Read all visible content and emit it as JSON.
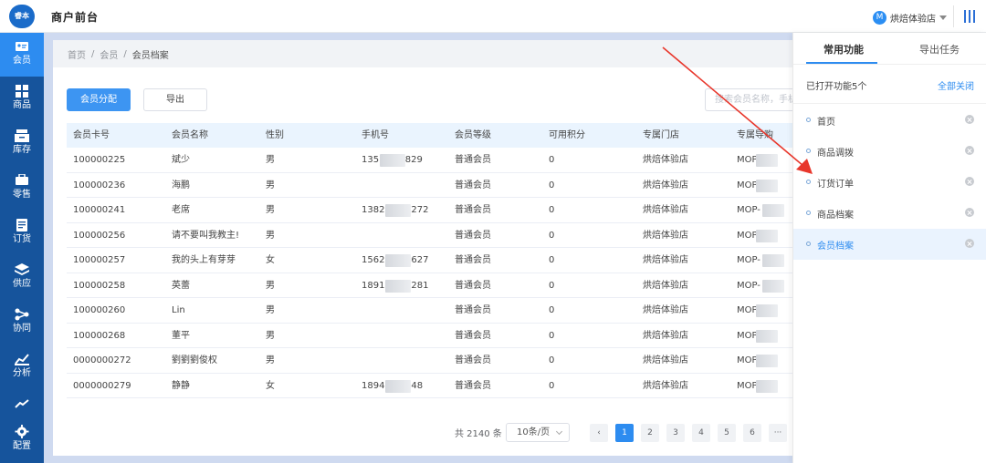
{
  "header": {
    "logo_text": "睿本",
    "title": "商户前台",
    "store_badge": "M",
    "store_name": "烘焙体验店"
  },
  "sidebar": {
    "items": [
      {
        "label": "会员",
        "icon": "member-card-icon",
        "active": true
      },
      {
        "label": "商品",
        "icon": "grid-icon"
      },
      {
        "label": "库存",
        "icon": "inventory-icon"
      },
      {
        "label": "零售",
        "icon": "retail-icon"
      },
      {
        "label": "订货",
        "icon": "order-icon"
      },
      {
        "label": "供应",
        "icon": "layers-icon"
      },
      {
        "label": "协同",
        "icon": "share-icon"
      },
      {
        "label": "分析",
        "icon": "chart-icon"
      },
      {
        "label": "配置",
        "icon": "gear-icon"
      }
    ]
  },
  "breadcrumb": {
    "home": "首页",
    "section": "会员",
    "current": "会员档案"
  },
  "toolbar": {
    "assign_label": "会员分配",
    "export_label": "导出",
    "search_placeholder": "搜索会员名称，手机"
  },
  "table": {
    "columns": [
      "会员卡号",
      "会员名称",
      "性别",
      "手机号",
      "会员等级",
      "可用积分",
      "专属门店",
      "专属导购"
    ],
    "rows": [
      {
        "card": "100000225",
        "name": "斌少",
        "gender": "男",
        "phone_a": "135",
        "phone_b": "829",
        "level": "普通会员",
        "points": "0",
        "store": "烘焙体验店",
        "guide": "MOP"
      },
      {
        "card": "100000236",
        "name": "海鹏",
        "gender": "男",
        "phone_a": "",
        "phone_b": "",
        "level": "普通会员",
        "points": "0",
        "store": "烘焙体验店",
        "guide": "MOP"
      },
      {
        "card": "100000241",
        "name": "老席",
        "gender": "男",
        "phone_a": "1382",
        "phone_b": "272",
        "level": "普通会员",
        "points": "0",
        "store": "烘焙体验店",
        "guide": "MOP-"
      },
      {
        "card": "100000256",
        "name": "请不要叫我教主!",
        "gender": "男",
        "phone_a": "",
        "phone_b": "",
        "level": "普通会员",
        "points": "0",
        "store": "烘焙体验店",
        "guide": "MOP"
      },
      {
        "card": "100000257",
        "name": "我的头上有芽芽",
        "gender": "女",
        "phone_a": "1562",
        "phone_b": "627",
        "level": "普通会员",
        "points": "0",
        "store": "烘焙体验店",
        "guide": "MOP-"
      },
      {
        "card": "100000258",
        "name": "英蕾",
        "gender": "男",
        "phone_a": "1891",
        "phone_b": "281",
        "level": "普通会员",
        "points": "0",
        "store": "烘焙体验店",
        "guide": "MOP-"
      },
      {
        "card": "100000260",
        "name": "Lin",
        "gender": "男",
        "phone_a": "",
        "phone_b": "",
        "level": "普通会员",
        "points": "0",
        "store": "烘焙体验店",
        "guide": "MOP"
      },
      {
        "card": "100000268",
        "name": "董平",
        "gender": "男",
        "phone_a": "",
        "phone_b": "",
        "level": "普通会员",
        "points": "0",
        "store": "烘焙体验店",
        "guide": "MOP"
      },
      {
        "card": "0000000272",
        "name": "劉劉劉俊权",
        "gender": "男",
        "phone_a": "",
        "phone_b": "",
        "level": "普通会员",
        "points": "0",
        "store": "烘焙体验店",
        "guide": "MOP"
      },
      {
        "card": "0000000279",
        "name": "静静",
        "gender": "女",
        "phone_a": "1894",
        "phone_b": "48",
        "level": "普通会员",
        "points": "0",
        "store": "烘焙体验店",
        "guide": "MOP"
      }
    ]
  },
  "pagination": {
    "total_text": "共 2140 条",
    "page_size": "10条/页",
    "prev": "‹",
    "pages": [
      "1",
      "2",
      "3",
      "4",
      "5",
      "6"
    ],
    "more": "···",
    "current": "1"
  },
  "right_panel": {
    "tab_common": "常用功能",
    "tab_export": "导出任务",
    "opened_text": "已打开功能5个",
    "close_all": "全部关闭",
    "items": [
      {
        "label": "首页"
      },
      {
        "label": "商品调拨"
      },
      {
        "label": "订货订单"
      },
      {
        "label": "商品档案"
      },
      {
        "label": "会员档案",
        "active": true
      }
    ]
  },
  "colors": {
    "accent": "#2d8cf0",
    "sidebar": "#16549c",
    "annotation_arrow": "#e8372c"
  }
}
